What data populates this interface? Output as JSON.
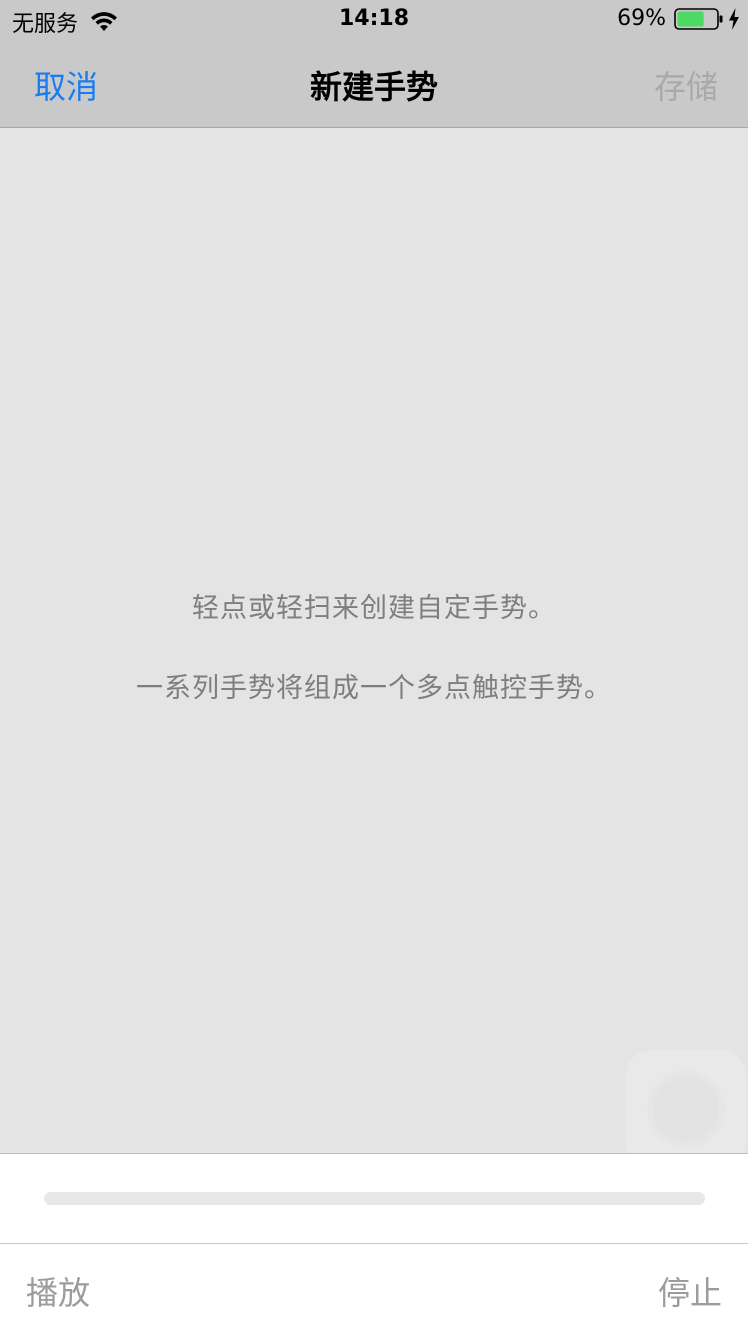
{
  "status_bar": {
    "carrier": "无服务",
    "time": "14:18",
    "battery_percent": "69%",
    "battery_level": 0.69,
    "battery_color": "#4cd964",
    "icons": [
      "wifi-icon",
      "battery-icon",
      "charging-bolt-icon"
    ]
  },
  "nav": {
    "cancel_label": "取消",
    "title": "新建手势",
    "save_label": "存储",
    "accent_color": "#1a7cf0",
    "disabled_color": "#a9a9a9"
  },
  "gesture_area": {
    "instruction_line1": "轻点或轻扫来创建自定手势。",
    "instruction_line2": "一系列手势将组成一个多点触控手势。"
  },
  "timeline": {
    "progress": 0
  },
  "toolbar": {
    "play_label": "播放",
    "stop_label": "停止"
  }
}
